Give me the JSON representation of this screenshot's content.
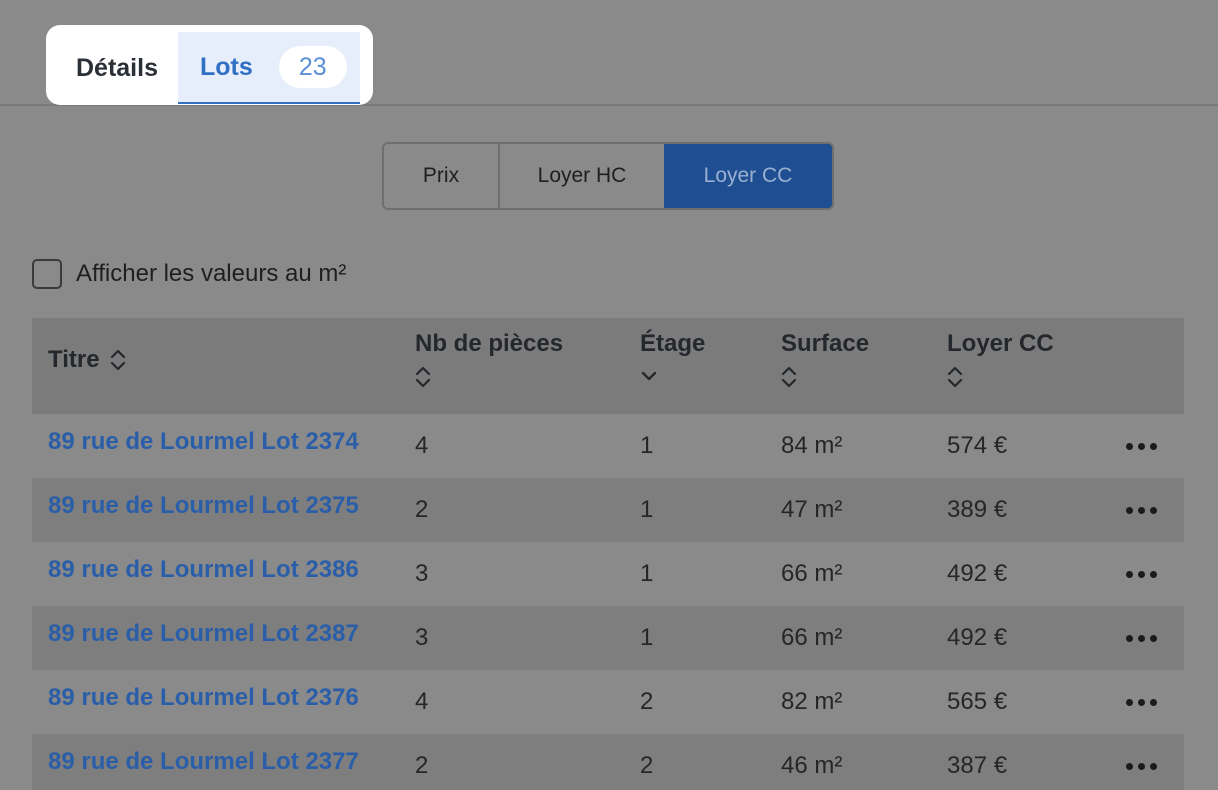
{
  "tabs": {
    "details_label": "Détails",
    "lots_label": "Lots",
    "lots_count": "23"
  },
  "price_mode": {
    "options": [
      "Prix",
      "Loyer HC",
      "Loyer CC"
    ],
    "selected": "Loyer CC"
  },
  "per_m2_checkbox": {
    "label": "Afficher les valeurs au m²",
    "checked": false
  },
  "table": {
    "headers": {
      "titre": "Titre",
      "pieces": "Nb de pièces",
      "etage": "Étage",
      "surface": "Surface",
      "loyer": "Loyer CC"
    },
    "rows": [
      {
        "titre": "89 rue de Lourmel Lot 2374",
        "pieces": "4",
        "etage": "1",
        "surface": "84 m²",
        "loyer": "574 €"
      },
      {
        "titre": "89 rue de Lourmel Lot 2375",
        "pieces": "2",
        "etage": "1",
        "surface": "47 m²",
        "loyer": "389 €"
      },
      {
        "titre": "89 rue de Lourmel Lot 2386",
        "pieces": "3",
        "etage": "1",
        "surface": "66 m²",
        "loyer": "492 €"
      },
      {
        "titre": "89 rue de Lourmel Lot 2387",
        "pieces": "3",
        "etage": "1",
        "surface": "66 m²",
        "loyer": "492 €"
      },
      {
        "titre": "89 rue de Lourmel Lot 2376",
        "pieces": "4",
        "etage": "2",
        "surface": "82 m²",
        "loyer": "565 €"
      },
      {
        "titre": "89 rue de Lourmel Lot 2377",
        "pieces": "2",
        "etage": "2",
        "surface": "46 m²",
        "loyer": "387 €"
      }
    ]
  },
  "icons": {
    "sort": "sort-updown-icon",
    "sort_desc": "chevron-down-icon",
    "more": "more-horizontal-icon"
  },
  "colors": {
    "accent": "#2f6fc4",
    "selected_segment": "#1f4e93",
    "link": "#2a5ea8"
  }
}
